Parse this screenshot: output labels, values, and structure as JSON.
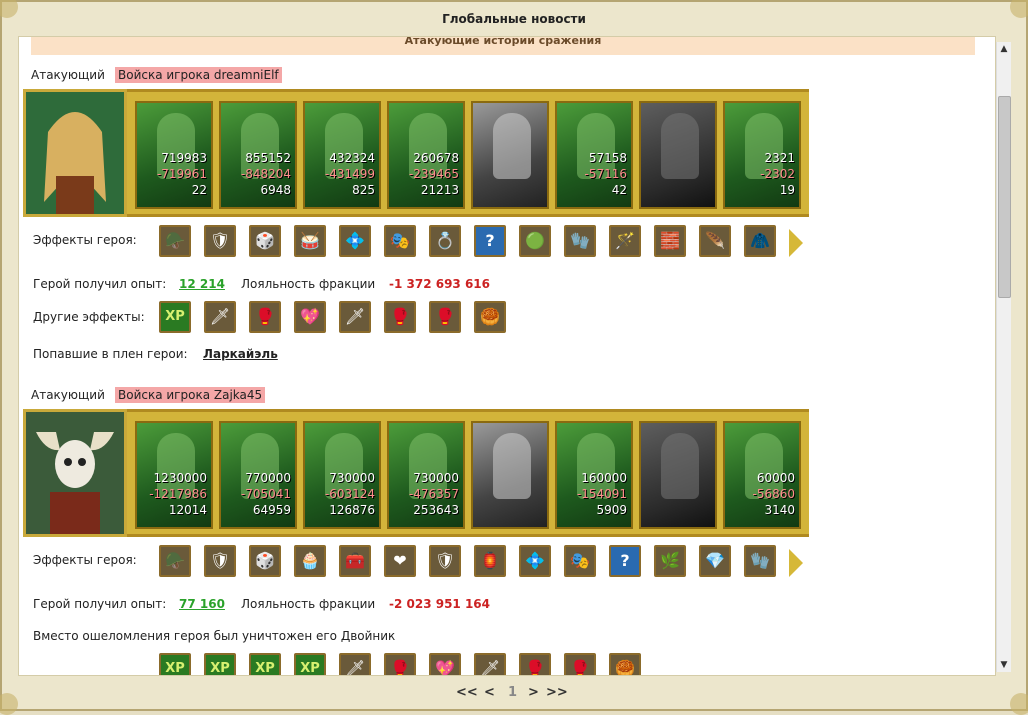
{
  "window": {
    "title": "Глобальные новости"
  },
  "banner": {
    "text": "Атакующие истории сражения"
  },
  "battles": [
    {
      "attacker_label": "Атакующий",
      "player_tag": "Войска игрока dreamniElf",
      "units": [
        {
          "style": "green",
          "n1": "719983",
          "n2": "-719961",
          "n3": "22"
        },
        {
          "style": "green",
          "n1": "855152",
          "n2": "-848204",
          "n3": "6948"
        },
        {
          "style": "green",
          "n1": "432324",
          "n2": "-431499",
          "n3": "825"
        },
        {
          "style": "green",
          "n1": "260678",
          "n2": "-239465",
          "n3": "21213"
        },
        {
          "style": "grey",
          "n1": "",
          "n2": "",
          "n3": ""
        },
        {
          "style": "green",
          "n1": "57158",
          "n2": "-57116",
          "n3": "42"
        },
        {
          "style": "dark",
          "n1": "",
          "n2": "",
          "n3": ""
        },
        {
          "style": "green",
          "n1": "2321",
          "n2": "-2302",
          "n3": "19"
        }
      ],
      "hero_effects_label": "Эффекты героя:",
      "hero_effects": [
        "🪖",
        "🛡",
        "🎲",
        "🥁",
        "💠",
        "🎭",
        "💍",
        "?",
        "🟢",
        "🧤",
        "🪄",
        "🧱",
        "🪶",
        "🧥"
      ],
      "exp_label": "Герой получил опыт:",
      "exp_value": "12 214",
      "loyalty_label": "Лояльность фракции",
      "loyalty_value": "-1 372 693 616",
      "other_effects_label": "Другие эффекты:",
      "other_effects": [
        "XP",
        "🗡",
        "🥊",
        "💖",
        "🗡",
        "🥊",
        "🥊",
        "🥮"
      ],
      "captured_label": "Попавшие в плен герои:",
      "captured_name": "Ларкайэль"
    },
    {
      "attacker_label": "Атакующий",
      "player_tag": "Войска игрока Zajka45",
      "units": [
        {
          "style": "green",
          "n1": "1230000",
          "n2": "-1217986",
          "n3": "12014"
        },
        {
          "style": "green",
          "n1": "770000",
          "n2": "-705041",
          "n3": "64959"
        },
        {
          "style": "green",
          "n1": "730000",
          "n2": "-603124",
          "n3": "126876"
        },
        {
          "style": "green",
          "n1": "730000",
          "n2": "-476357",
          "n3": "253643"
        },
        {
          "style": "grey",
          "n1": "",
          "n2": "",
          "n3": ""
        },
        {
          "style": "green",
          "n1": "160000",
          "n2": "-154091",
          "n3": "5909"
        },
        {
          "style": "dark",
          "n1": "",
          "n2": "",
          "n3": ""
        },
        {
          "style": "green",
          "n1": "60000",
          "n2": "-56860",
          "n3": "3140"
        }
      ],
      "hero_effects_label": "Эффекты героя:",
      "hero_effects": [
        "🪖",
        "🛡",
        "🎲",
        "🧁",
        "🧰",
        "❤",
        "🛡",
        "🏮",
        "💠",
        "🎭",
        "?",
        "🌿",
        "💎",
        "🧤"
      ],
      "exp_label": "Герой получил опыт:",
      "exp_value": "77 160",
      "loyalty_label": "Лояльность фракции",
      "loyalty_value": "-2 023 951 164",
      "note": "Вместо ошеломления героя был уничтожен его Двойник",
      "other_effects": [
        "XP",
        "XP",
        "XP",
        "XP",
        "🗡",
        "🥊",
        "💖",
        "🗡",
        "🥊",
        "🥊",
        "🥮"
      ]
    }
  ],
  "pager": {
    "first": "<<",
    "prev": "<",
    "current": "1",
    "next": ">",
    "last": ">>"
  }
}
